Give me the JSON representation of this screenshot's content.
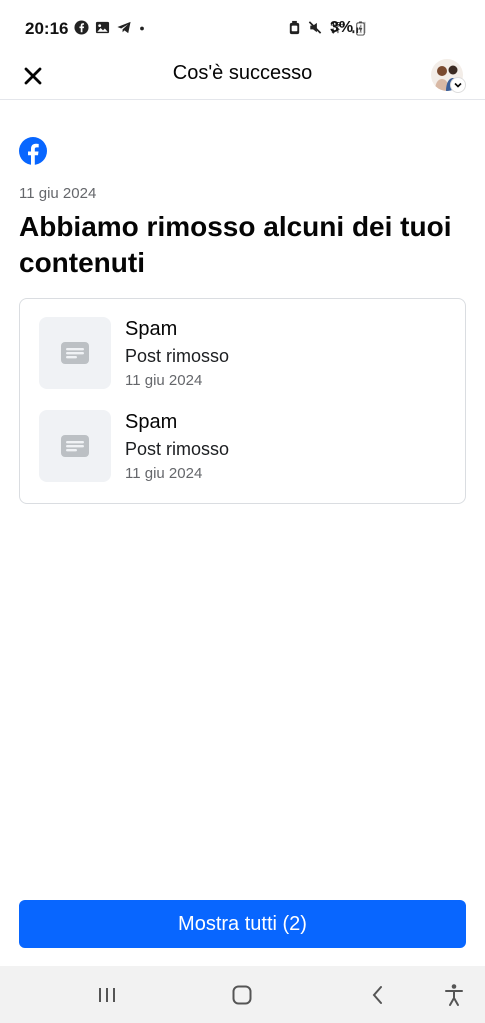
{
  "status_bar": {
    "time": "20:16",
    "battery": "3%",
    "icons_left": [
      "facebook-icon",
      "image-icon",
      "telegram-icon",
      "dot-icon"
    ],
    "icons_right": [
      "alarm-icon",
      "mute-icon",
      "network-4g-icon",
      "signal-icon"
    ]
  },
  "header": {
    "title": "Cos'è successo"
  },
  "main": {
    "date": "11 giu 2024",
    "headline": "Abbiamo rimosso alcuni dei tuoi contenuti",
    "items": [
      {
        "title": "Spam",
        "subtitle": "Post rimosso",
        "date": "11 giu 2024"
      },
      {
        "title": "Spam",
        "subtitle": "Post rimosso",
        "date": "11 giu 2024"
      }
    ]
  },
  "footer": {
    "button_label": "Mostra tutti (2)"
  },
  "colors": {
    "accent": "#0866ff",
    "thumb_bg": "#f0f2f5",
    "muted_text": "#65676b"
  }
}
